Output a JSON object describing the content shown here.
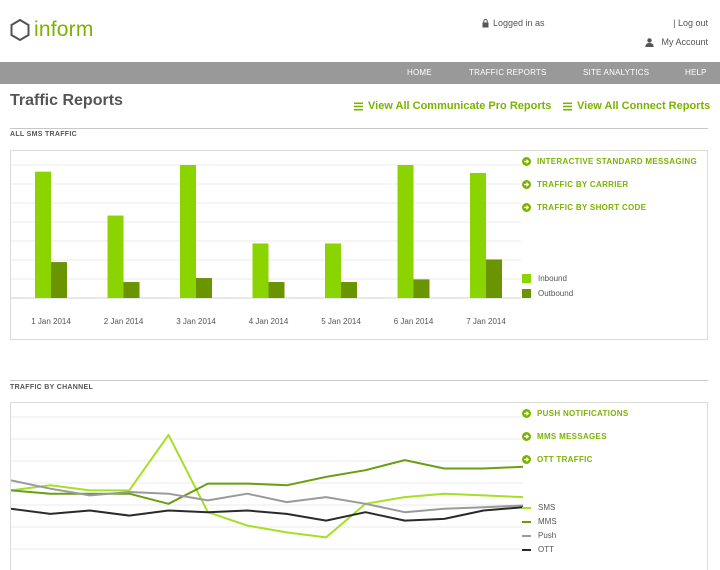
{
  "header": {
    "logo_text": "inform",
    "login_status": "Logged in as",
    "logout": "| Log out",
    "my_account": "My Account"
  },
  "nav": {
    "items": [
      {
        "label": "HOME"
      },
      {
        "label": "TRAFFIC REPORTS"
      },
      {
        "label": "SITE ANALYTICS"
      },
      {
        "label": "HELP"
      }
    ]
  },
  "page": {
    "title": "Traffic Reports",
    "link_communicate": "View All Communicate Pro Reports",
    "link_connect": "View All Connect Reports"
  },
  "colors": {
    "brand_green": "#7cb300",
    "inbound": "#8cd400",
    "outbound": "#6a9400",
    "nav_bg": "#999999",
    "sms": "#a4e024",
    "mms": "#6a9e14",
    "push": "#9a9a9a",
    "ott": "#2a2a2a"
  },
  "sms_section": {
    "label": "ALL SMS TRAFFIC",
    "links": [
      {
        "label": "INTERACTIVE STANDARD MESSAGING",
        "icon": "circle-arrow-icon"
      },
      {
        "label": "TRAFFIC BY CARRIER",
        "icon": "circle-arrow-icon"
      },
      {
        "label": "TRAFFIC BY SHORT CODE",
        "icon": "circle-arrow-icon"
      }
    ],
    "legend": [
      {
        "label": "Inbound"
      },
      {
        "label": "Outbound"
      }
    ]
  },
  "channel_section": {
    "label": "TRAFFIC BY CHANNEL",
    "links": [
      {
        "label": "PUSH NOTIFICATIONS",
        "icon": "circle-arrow-icon"
      },
      {
        "label": "MMS MESSAGES",
        "icon": "circle-arrow-icon"
      },
      {
        "label": "OTT TRAFFIC",
        "icon": "circle-arrow-icon"
      }
    ],
    "legend": [
      {
        "label": "SMS"
      },
      {
        "label": "MMS"
      },
      {
        "label": "Push"
      },
      {
        "label": "OTT"
      }
    ]
  },
  "chart_data": [
    {
      "type": "bar",
      "title": "ALL SMS TRAFFIC",
      "categories": [
        "1 Jan 2014",
        "2 Jan 2014",
        "3 Jan 2014",
        "4 Jan 2014",
        "5 Jan 2014",
        "6 Jan 2014",
        "7 Jan 2014"
      ],
      "series": [
        {
          "name": "Inbound",
          "values": [
            95,
            62,
            100,
            41,
            41,
            100,
            94
          ]
        },
        {
          "name": "Outbound",
          "values": [
            27,
            12,
            15,
            12,
            12,
            14,
            29
          ]
        }
      ],
      "ylim": [
        0,
        100
      ],
      "grid": true,
      "legend": "right"
    },
    {
      "type": "line",
      "title": "TRAFFIC BY CHANNEL",
      "x": [
        0,
        1,
        2,
        3,
        4,
        5,
        6,
        7,
        8,
        9,
        10,
        11,
        12,
        13
      ],
      "series": [
        {
          "name": "SMS",
          "values": [
            48,
            51,
            48,
            48,
            81,
            35,
            27,
            23,
            20,
            40,
            44,
            46,
            45,
            44
          ]
        },
        {
          "name": "MMS",
          "values": [
            48,
            46,
            46,
            46,
            40,
            52,
            52,
            51,
            56,
            60,
            66,
            61,
            61,
            62
          ]
        },
        {
          "name": "Push",
          "values": [
            54,
            49,
            45,
            47,
            46,
            42,
            46,
            41,
            44,
            40,
            35,
            37,
            38,
            39
          ]
        },
        {
          "name": "OTT",
          "values": [
            37,
            34,
            36,
            33,
            36,
            35,
            36,
            34,
            30,
            35,
            30,
            31,
            36,
            38
          ]
        }
      ],
      "ylim": [
        0,
        100
      ],
      "grid": true,
      "legend": "right"
    }
  ]
}
